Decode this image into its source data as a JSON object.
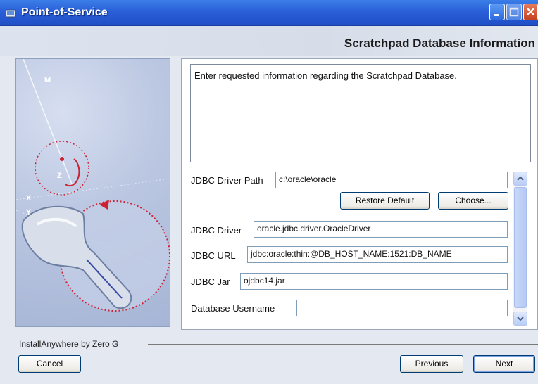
{
  "window": {
    "title": "Point-of-Service"
  },
  "header": {
    "title": "Scratchpad Database Information"
  },
  "content": {
    "description": "Enter requested information regarding the Scratchpad Database.",
    "fields": {
      "jdbc_driver_path": {
        "label": "JDBC Driver Path",
        "value": "c:\\oracle\\oracle"
      },
      "jdbc_driver": {
        "label": "JDBC Driver",
        "value": "oracle.jdbc.driver.OracleDriver"
      },
      "jdbc_url": {
        "label": "JDBC URL",
        "value": "jdbc:oracle:thin:@DB_HOST_NAME:1521:DB_NAME"
      },
      "jdbc_jar": {
        "label": "JDBC Jar",
        "value": "ojdbc14.jar"
      },
      "db_username": {
        "label": "Database Username",
        "value": ""
      }
    },
    "restore_default_label": "Restore Default",
    "choose_label": "Choose..."
  },
  "graphic": {
    "letters": [
      "M",
      "Z",
      "X",
      "Y"
    ]
  },
  "footer": {
    "installer_label": "InstallAnywhere by Zero G",
    "cancel_label": "Cancel",
    "previous_label": "Previous",
    "next_label": "Next"
  },
  "colors": {
    "titlebar": "#2a5fd8",
    "accent_red": "#cc2233"
  }
}
